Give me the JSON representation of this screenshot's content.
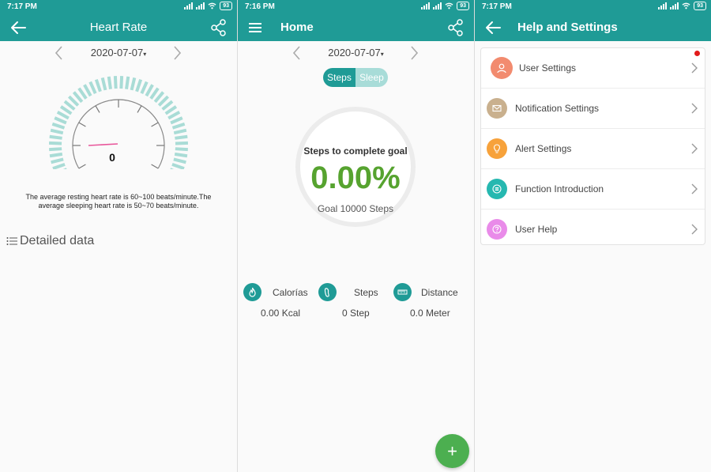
{
  "panels": [
    {
      "status_time": "7:17 PM",
      "battery": "93",
      "title": "Heart Rate",
      "date": "2020-07-07",
      "gauge_reading": "0",
      "note": "The average resting heart rate is 60~100 beats/minute.The average sleeping heart rate is 50~70 beats/minute.",
      "detailed_label": "Detailed data"
    },
    {
      "status_time": "7:16 PM",
      "battery": "93",
      "title": "Home",
      "date": "2020-07-07",
      "toggle_steps": "Steps",
      "toggle_sleep": "Sleep",
      "goal_label": "Steps to complete goal",
      "goal_percent": "0.00%",
      "goal_text": "Goal 10000 Steps",
      "stats": [
        {
          "name": "Calorías",
          "value": "0.00 Kcal",
          "icon": "flame-icon"
        },
        {
          "name": "Steps",
          "value": "0 Step",
          "icon": "footprint-icon"
        },
        {
          "name": "Distance",
          "value": "0.0 Meter",
          "icon": "ruler-icon"
        }
      ],
      "fab": "+"
    },
    {
      "status_time": "7:17 PM",
      "battery": "93",
      "title": "Help and Settings",
      "items": [
        {
          "label": "User Settings",
          "color": "#f28b6f",
          "icon": "user-icon"
        },
        {
          "label": "Notification Settings",
          "color": "#c9b08e",
          "icon": "envelope-icon"
        },
        {
          "label": "Alert Settings",
          "color": "#f7a23b",
          "icon": "bulb-icon"
        },
        {
          "label": "Function Introduction",
          "color": "#26b8b0",
          "icon": "list-icon"
        },
        {
          "label": "User Help",
          "color": "#e98be9",
          "icon": "question-icon"
        }
      ]
    }
  ]
}
